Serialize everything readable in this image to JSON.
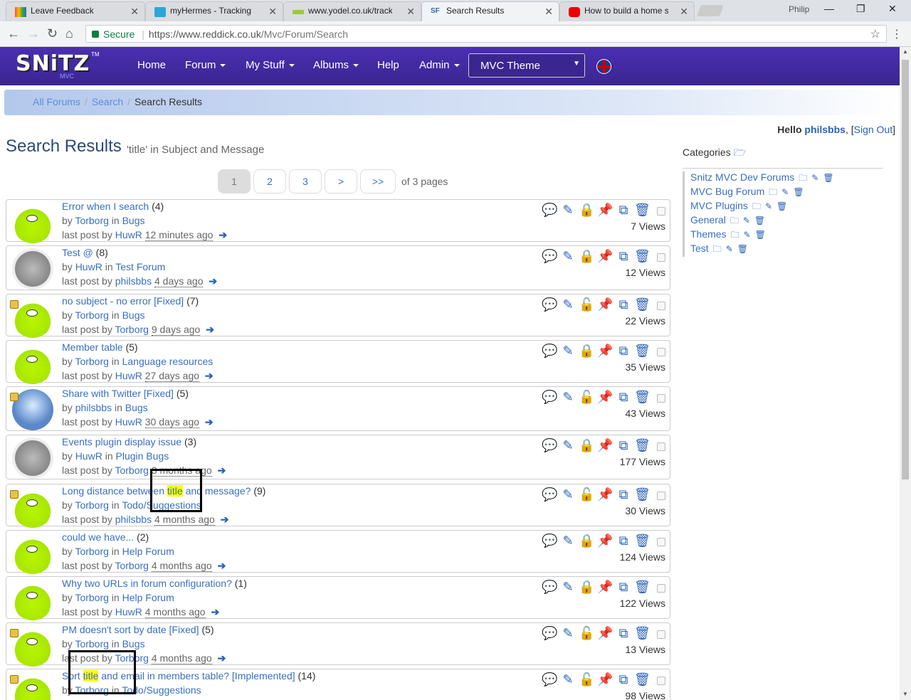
{
  "browser": {
    "tabs": [
      {
        "title": "Leave Feedback",
        "favicon": "colorful-bag-icon"
      },
      {
        "title": "myHermes - Tracking res",
        "favicon": "hermes-icon"
      },
      {
        "title": "www.yodel.co.uk/tracking",
        "favicon": "yodel-icon"
      },
      {
        "title": "Search Results",
        "favicon": "snitz-icon",
        "active": true
      },
      {
        "title": "How to build a home serv",
        "favicon": "youtube-icon"
      }
    ],
    "user": "Philip",
    "secure_label": "Secure",
    "url_prefix": "https://www.reddick.co.uk",
    "url_path": "/Mvc/Forum/Search"
  },
  "header": {
    "logo": "SNiTZ",
    "logo_sub": "MVC",
    "logo_tm": "TM",
    "nav": {
      "home": "Home",
      "forum": "Forum",
      "mystuff": "My Stuff",
      "albums": "Albums",
      "help": "Help",
      "admin": "Admin"
    },
    "theme_select": "MVC Theme"
  },
  "breadcrumb": {
    "all": "All Forums",
    "search": "Search",
    "current": "Search Results"
  },
  "greeting": {
    "hello": "Hello",
    "user": "philsbbs",
    "signout": "Sign Out"
  },
  "page": {
    "title": "Search Results",
    "subtitle": "'title' in Subject and Message"
  },
  "pager": {
    "pages": [
      "1",
      "2",
      "3",
      ">",
      ">>"
    ],
    "current": "1",
    "info": "of 3 pages"
  },
  "topics": [
    {
      "title": "Error when I search",
      "count": "(4)",
      "author": "Torborg",
      "forum": "Bugs",
      "lastby": "HuwR",
      "when": "12 minutes ago",
      "views": "7 Views",
      "avatar": "lime",
      "locked": false,
      "unlock": false
    },
    {
      "title": "Test @",
      "count": "(8)",
      "author": "HuwR",
      "forum": "Test Forum",
      "lastby": "philsbbs",
      "when": "4 days ago",
      "views": "12 Views",
      "avatar": "gray",
      "locked": false,
      "unlock": false
    },
    {
      "title": "no subject - no error [Fixed]",
      "count": "(7)",
      "author": "Torborg",
      "forum": "Bugs",
      "lastby": "Torborg",
      "when": "9 days ago",
      "views": "22 Views",
      "avatar": "lime",
      "locked": true,
      "unlock": true
    },
    {
      "title": "Member table",
      "count": "(5)",
      "author": "Torborg",
      "forum": "Language resources",
      "lastby": "HuwR",
      "when": "27 days ago",
      "views": "35 Views",
      "avatar": "lime",
      "locked": false,
      "unlock": false
    },
    {
      "title": "Share with Twitter [Fixed]",
      "count": "(5)",
      "author": "philsbbs",
      "forum": "Bugs",
      "lastby": "HuwR",
      "when": "30 days ago",
      "views": "43 Views",
      "avatar": "sky",
      "locked": true,
      "unlock": true
    },
    {
      "title": "Events plugin display issue",
      "count": "(3)",
      "author": "HuwR",
      "forum": "Plugin Bugs",
      "lastby": "Torborg",
      "when": "3 months ago",
      "views": "177 Views",
      "avatar": "gray",
      "locked": false,
      "unlock": false
    },
    {
      "title_pre": "Long distance between ",
      "title_hl": "title",
      "title_post": " and message?",
      "count": "(9)",
      "author": "Torborg",
      "forum": "Todo/Suggestions",
      "lastby": "philsbbs",
      "when": "4 months ago",
      "views": "30 Views",
      "avatar": "lime",
      "locked": true,
      "unlock": true
    },
    {
      "title": "could we have...",
      "count": "(2)",
      "author": "Torborg",
      "forum": "Help Forum",
      "lastby": "Torborg",
      "when": "4 months ago",
      "views": "124 Views",
      "avatar": "lime",
      "locked": false,
      "unlock": false
    },
    {
      "title": "Why two URLs in forum configuration?",
      "count": "(1)",
      "author": "Torborg",
      "forum": "Help Forum",
      "lastby": "HuwR",
      "when": "4 months ago",
      "views": "122 Views",
      "avatar": "lime",
      "locked": false,
      "unlock": false
    },
    {
      "title": "PM doesn't sort by date [Fixed]",
      "count": "(5)",
      "author": "Torborg",
      "forum": "Bugs",
      "lastby": "Torborg",
      "when": "4 months ago",
      "views": "13 Views",
      "avatar": "lime",
      "locked": true,
      "unlock": true
    },
    {
      "title_pre": "Sort ",
      "title_hl": "title",
      "title_post": " and email in members table? [Implemented]",
      "count": "(14)",
      "author": "Torborg",
      "forum": "Todo/Suggestions",
      "lastby": "",
      "when": "",
      "views": "98 Views",
      "avatar": "lime",
      "locked": true,
      "unlock": true
    }
  ],
  "row_labels": {
    "by": "by",
    "in": "in",
    "lastpost": "last post by"
  },
  "categories": {
    "title": "Categories",
    "items": [
      "Snitz MVC Dev Forums",
      "MVC Bug Forum",
      "MVC Plugins",
      "General",
      "Themes",
      "Test"
    ]
  },
  "colors": {
    "navbar": "#3b2590",
    "link": "#3a6fc0",
    "highlight": "#ffff00"
  }
}
